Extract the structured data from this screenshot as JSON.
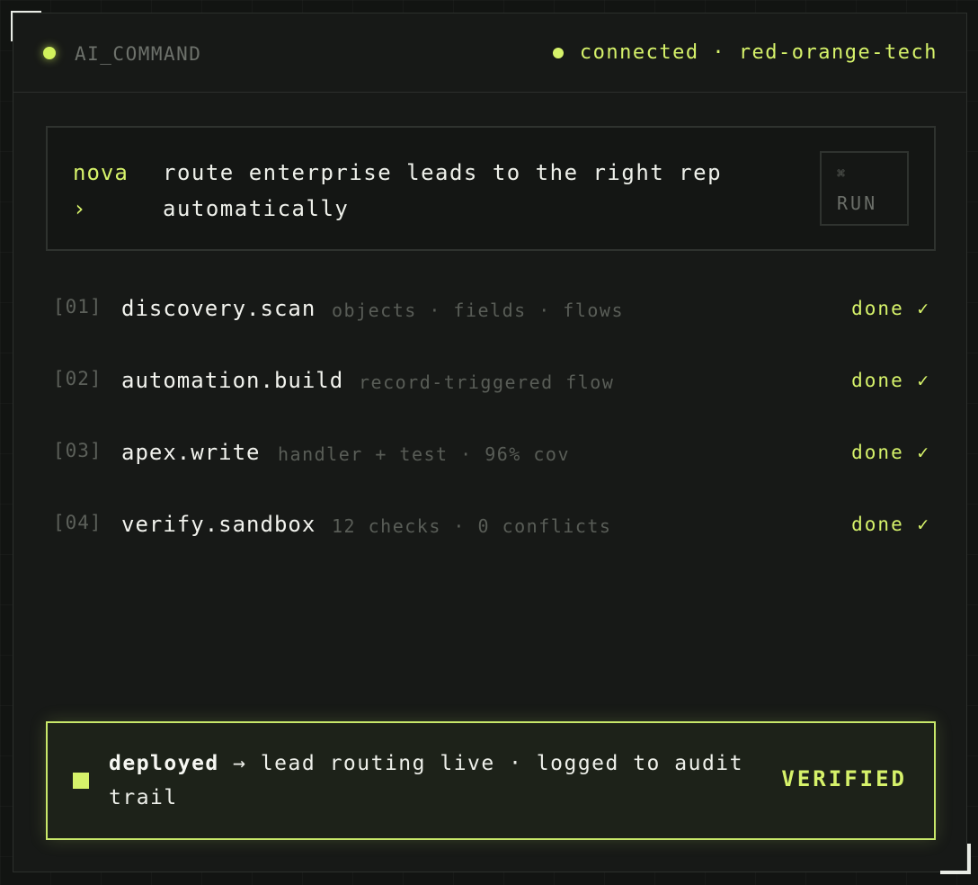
{
  "header": {
    "title": "AI_COMMAND",
    "status": "connected · red-orange-tech"
  },
  "command": {
    "prompt": "nova ›",
    "query": "route enterprise leads to the right rep automatically",
    "run_shortcut": "⌘",
    "run_label": "RUN"
  },
  "steps": [
    {
      "index": "[01]",
      "name": "discovery.scan",
      "detail": "objects · fields · flows",
      "status": "done ✓"
    },
    {
      "index": "[02]",
      "name": "automation.build",
      "detail": "record-triggered flow",
      "status": "done ✓"
    },
    {
      "index": "[03]",
      "name": "apex.write",
      "detail": "handler + test · 96% cov",
      "status": "done ✓"
    },
    {
      "index": "[04]",
      "name": "verify.sandbox",
      "detail": "12 checks · 0 conflicts",
      "status": "done ✓"
    }
  ],
  "result": {
    "label": "deployed",
    "message": "→ lead routing live · logged to audit trail",
    "badge": "VERIFIED"
  },
  "colors": {
    "accent": "#d6f26a",
    "background": "#121412",
    "panel": "#171917"
  }
}
